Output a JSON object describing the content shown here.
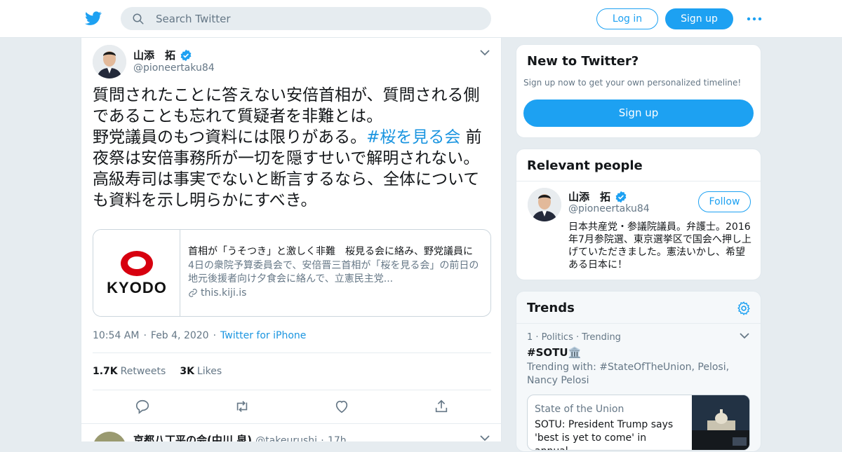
{
  "header": {
    "search_placeholder": "Search Twitter",
    "login_label": "Log in",
    "signup_label": "Sign up"
  },
  "tweet": {
    "author_name": "山添　拓",
    "author_handle": "@pioneertaku84",
    "text_line1": "質問されたことに答えない安倍首相が、質問される側であることも忘れて質疑者を非難とは。",
    "text_line2_pre": "野党議員のもつ資料には限りがある。",
    "hashtag": "#桜を見る会",
    "text_line2_post": " 前夜祭は安倍事務所が一切を隠すせいで解明されない。",
    "text_line3": "高級寿司は事実でないと断言するなら、全体についても資料を示し明らかにすべき。",
    "card": {
      "logo_text": "KYODO",
      "title": "首相が「うそつき」と激しく非難　桜見る会に絡み、野党議員に",
      "description": "4日の衆院予算委員会で、安倍晋三首相が「桜を見る会」の前日の地元後援者向け夕食会に絡んで、立憲民主党...",
      "domain": "this.kiji.is"
    },
    "time": "10:54 AM",
    "date": "Feb 4, 2020",
    "via": "Twitter for iPhone",
    "retweets_count": "1.7K",
    "retweets_label": "Retweets",
    "likes_count": "3K",
    "likes_label": "Likes"
  },
  "next_tweet": {
    "author_name": "京都八丁平の会(中川 泉)",
    "author_handle": "@takeurushi",
    "age": "17h"
  },
  "new_to_twitter": {
    "title": "New to Twitter?",
    "subtitle": "Sign up now to get your own personalized timeline!",
    "signup_label": "Sign up"
  },
  "relevant_people": {
    "title": "Relevant people",
    "name": "山添　拓",
    "handle": "@pioneertaku84",
    "follow_label": "Follow",
    "bio": "日本共産党・参議院議員。弁護士。2016年7月参院選、東京選挙区で国会へ押し上げていただきました。憲法いかし、希望ある日本に！"
  },
  "trends": {
    "title": "Trends",
    "item_meta": "1 · Politics · Trending",
    "item_tag": "#SOTU🏛️",
    "item_with": "Trending with: #StateOfTheUnion, Pelosi, Nancy Pelosi",
    "card_source": "State of the Union",
    "card_title": "SOTU: President Trump says 'best is yet to come' in annual..."
  },
  "colors": {
    "accent": "#1da1f2",
    "link": "#1b95e0",
    "muted": "#657786",
    "background": "#e6ecf0"
  }
}
